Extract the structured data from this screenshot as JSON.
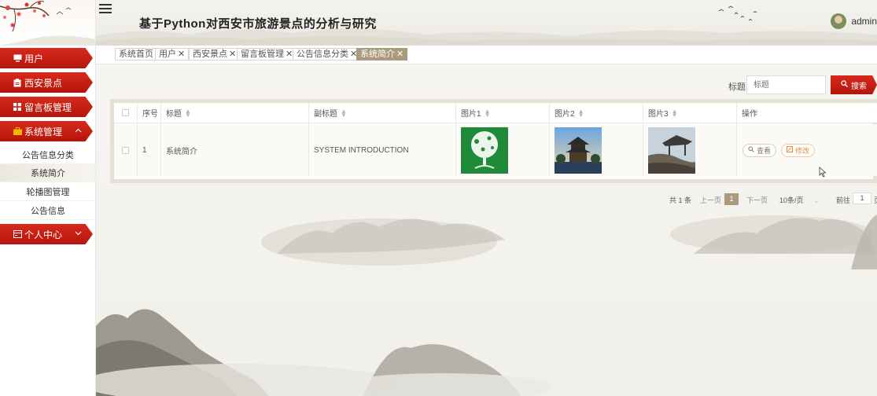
{
  "header": {
    "title": "基于Python对西安市旅游景点的分析与研究",
    "username": "admin"
  },
  "sidebar": {
    "items": [
      {
        "label": "用户",
        "icon": "monitor-icon"
      },
      {
        "label": "西安景点",
        "icon": "clipboard-icon"
      },
      {
        "label": "留言板管理",
        "icon": "grid-icon"
      },
      {
        "label": "系统管理",
        "icon": "briefcase-icon"
      },
      {
        "label": "个人中心",
        "icon": "card-icon"
      }
    ],
    "subitems": [
      "公告信息分类",
      "系统简介",
      "轮播图管理",
      "公告信息"
    ]
  },
  "tags": [
    "系统首页",
    "用户",
    "西安景点",
    "留言板管理",
    "公告信息分类",
    "系统简介"
  ],
  "search": {
    "label": "标题",
    "placeholder": "标题",
    "button": "搜索"
  },
  "table": {
    "columns": [
      "序号",
      "标题",
      "副标题",
      "图片1",
      "图片2",
      "图片3",
      "操作"
    ],
    "rows": [
      {
        "index": "1",
        "title": "系统简介",
        "subtitle": "SYSTEM INTRODUCTION"
      }
    ],
    "actions": {
      "view": "查看",
      "edit": "修改"
    }
  },
  "pagination": {
    "total": "共 1 条",
    "prev": "上一页",
    "page": "1",
    "next": "下一页",
    "page_size": "10条/页",
    "goto": "前往",
    "goto_value": "1",
    "goto_suffix": "页"
  },
  "colors": {
    "accent_red": "#c41e12",
    "tag_active": "#ab9a7d"
  }
}
